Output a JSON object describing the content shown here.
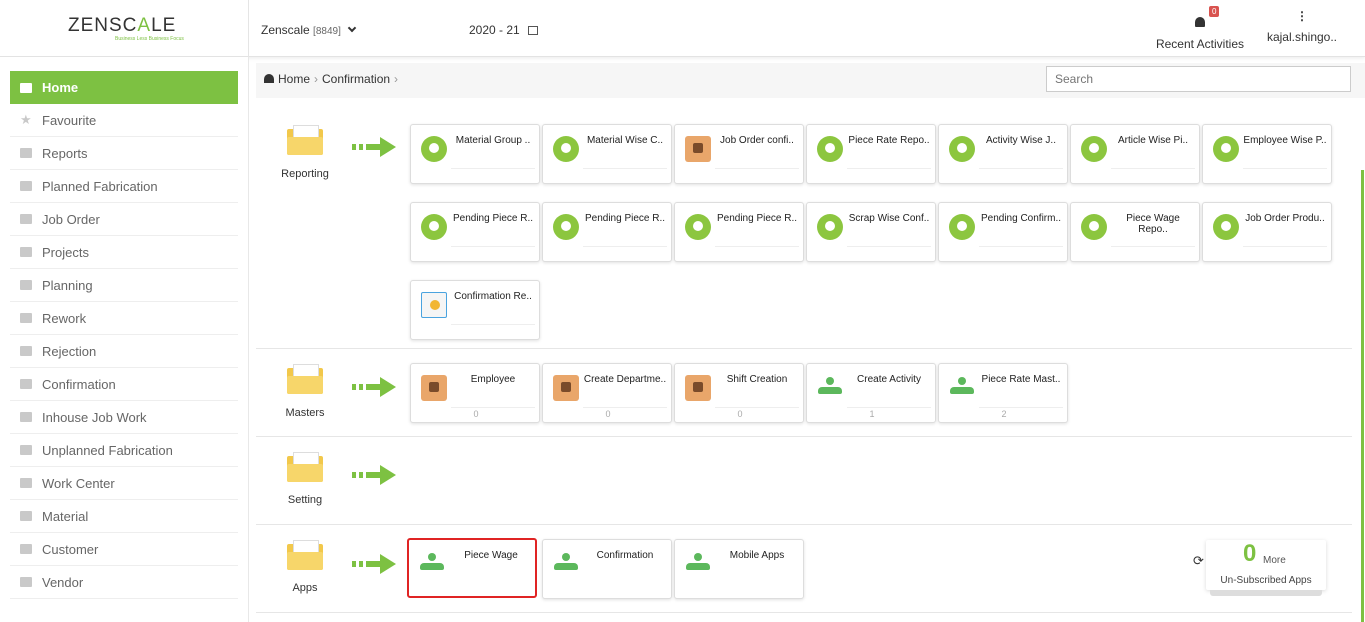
{
  "brand": {
    "logo_text_a": "ZENSC",
    "logo_text_b": "A",
    "logo_text_c": "LE",
    "tagline": "Business Less Business Focus"
  },
  "topbar": {
    "company": "Zenscale",
    "company_code": "[8849]",
    "year": "2020 - 21",
    "notifications_count": "0",
    "notifications_label": "Recent Activities",
    "user_label": "kajal.shingo.."
  },
  "sidebar": {
    "items": [
      {
        "label": "Home"
      },
      {
        "label": "Favourite"
      },
      {
        "label": "Reports"
      },
      {
        "label": "Planned Fabrication"
      },
      {
        "label": "Job Order"
      },
      {
        "label": "Projects"
      },
      {
        "label": "Planning"
      },
      {
        "label": "Rework"
      },
      {
        "label": "Rejection"
      },
      {
        "label": "Confirmation"
      },
      {
        "label": "Inhouse Job Work"
      },
      {
        "label": "Unplanned Fabrication"
      },
      {
        "label": "Work Center"
      },
      {
        "label": "Material"
      },
      {
        "label": "Customer"
      },
      {
        "label": "Vendor"
      }
    ]
  },
  "breadcrumb": {
    "home": "Home",
    "current": "Confirmation"
  },
  "search": {
    "placeholder": "Search"
  },
  "sections": {
    "reporting": {
      "label": "Reporting",
      "tiles": [
        {
          "title": "Material Group .."
        },
        {
          "title": "Material Wise C.."
        },
        {
          "title": "Job Order confi.."
        },
        {
          "title": "Piece Rate Repo.."
        },
        {
          "title": "Activity Wise J.."
        },
        {
          "title": "Article Wise Pi.."
        },
        {
          "title": "Employee Wise P.."
        },
        {
          "title": "Pending Piece R.."
        },
        {
          "title": "Pending Piece R.."
        },
        {
          "title": "Pending Piece R.."
        },
        {
          "title": "Scrap Wise Conf.."
        },
        {
          "title": "Pending Confirm.."
        },
        {
          "title": "Piece Wage Repo.."
        },
        {
          "title": "Job Order Produ.."
        },
        {
          "title": "Confirmation Re.."
        }
      ]
    },
    "masters": {
      "label": "Masters",
      "tiles": [
        {
          "title": "Employee",
          "count": "0"
        },
        {
          "title": "Create Departme..",
          "count": "0"
        },
        {
          "title": "Shift Creation",
          "count": "0"
        },
        {
          "title": "Create Activity",
          "count": "1"
        },
        {
          "title": "Piece Rate Mast..",
          "count": "2"
        }
      ]
    },
    "setting": {
      "label": "Setting"
    },
    "apps": {
      "label": "Apps",
      "tiles": [
        {
          "title": "Piece Wage"
        },
        {
          "title": "Confirmation"
        },
        {
          "title": "Mobile Apps"
        }
      ],
      "more_count": "0",
      "more_word": "More",
      "more_label": "Un-Subscribed Apps"
    }
  }
}
